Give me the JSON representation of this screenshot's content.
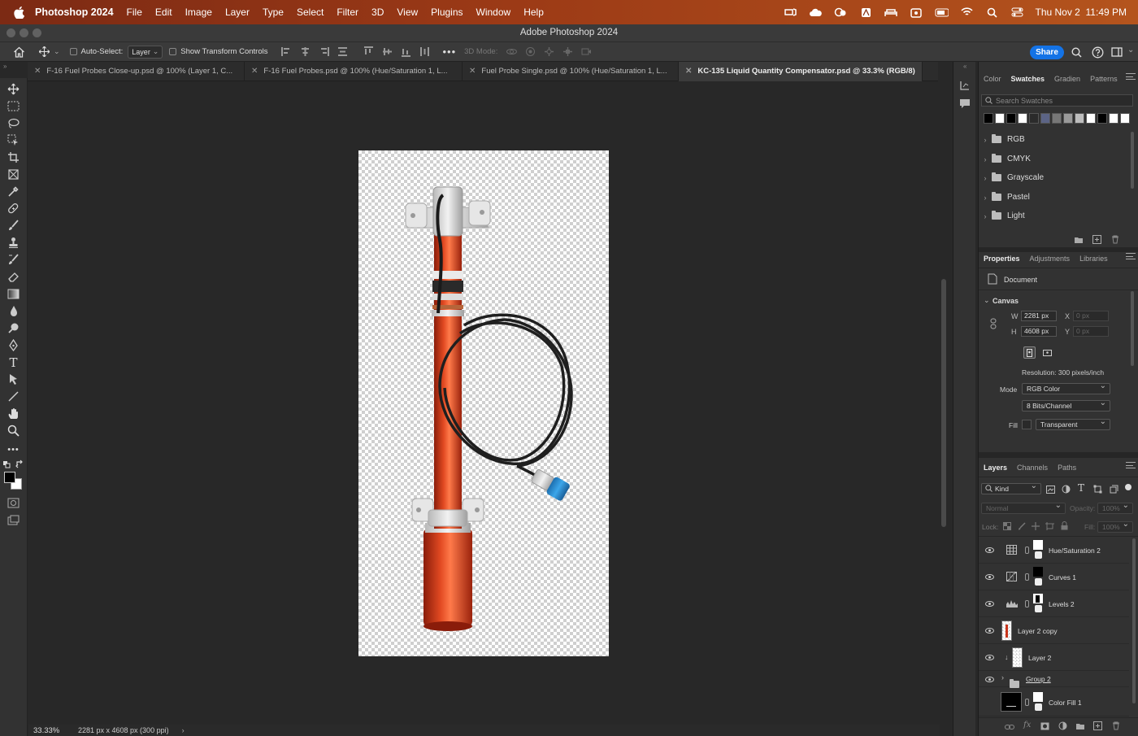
{
  "menubar": {
    "app_name": "Photoshop 2024",
    "items": [
      "File",
      "Edit",
      "Image",
      "Layer",
      "Type",
      "Select",
      "Filter",
      "3D",
      "View",
      "Plugins",
      "Window",
      "Help"
    ],
    "clock": "Thu Nov 2  11:49 PM"
  },
  "window": {
    "title": "Adobe Photoshop 2024"
  },
  "options_bar": {
    "auto_select_label": "Auto-Select:",
    "auto_select_value": "Layer",
    "show_transform_label": "Show Transform Controls",
    "mode_3d_label": "3D Mode:",
    "share_label": "Share"
  },
  "tabs": [
    {
      "label": "F-16 Fuel Probes Close-up.psd @ 100% (Layer 1, C...",
      "active": false
    },
    {
      "label": "F-16 Fuel Probes.psd @ 100% (Hue/Saturation 1, L...",
      "active": false
    },
    {
      "label": "Fuel Probe Single.psd @ 100% (Hue/Saturation 1, L...",
      "active": false
    },
    {
      "label": "KC-135 Liquid Quantity Compensator.psd @ 33.3% (RGB/8)",
      "active": true
    }
  ],
  "status": {
    "zoom": "33.33%",
    "doc_info": "2281 px x 4608 px (300 ppi)",
    "arrow": "›"
  },
  "swatches_panel": {
    "tabs": [
      "Color",
      "Swatches",
      "Gradien",
      "Patterns"
    ],
    "active_tab": "Swatches",
    "search_placeholder": "Search Swatches",
    "recent_colors": [
      "#000000",
      "#ffffff",
      "#000000",
      "#ffffff",
      "#2b2b2b",
      "#5c6485",
      "#777777",
      "#9a9a9a",
      "#bdbdbd",
      "#ffffff",
      "#000000",
      "#ffffff",
      "#ffffff"
    ],
    "groups": [
      "RGB",
      "CMYK",
      "Grayscale",
      "Pastel",
      "Light"
    ]
  },
  "properties_panel": {
    "tabs": [
      "Properties",
      "Adjustments",
      "Libraries"
    ],
    "active_tab": "Properties",
    "doc_label": "Document",
    "section": "Canvas",
    "w_label": "W",
    "w_value": "2281 px",
    "h_label": "H",
    "h_value": "4608 px",
    "x_label": "X",
    "x_value": "0 px",
    "y_label": "Y",
    "y_value": "0 px",
    "resolution": "Resolution: 300 pixels/inch",
    "mode_label": "Mode",
    "mode_value": "RGB Color",
    "depth_value": "8 Bits/Channel",
    "fill_label": "Fill",
    "fill_value": "Transparent"
  },
  "layers_panel": {
    "tabs": [
      "Layers",
      "Channels",
      "Paths"
    ],
    "active_tab": "Layers",
    "filter_value": "Kind",
    "blend_mode": "Normal",
    "opacity_label": "Opacity:",
    "opacity_value": "100%",
    "lock_label": "Lock:",
    "fill_label": "Fill:",
    "fill_value": "100%",
    "layers": [
      {
        "name": "Hue/Saturation 2",
        "visible": true
      },
      {
        "name": "Curves 1",
        "visible": true
      },
      {
        "name": "Levels 2",
        "visible": true
      },
      {
        "name": "Layer 2 copy",
        "visible": true
      },
      {
        "name": "Layer 2",
        "visible": true
      },
      {
        "name": "Group 2",
        "visible": true
      },
      {
        "name": "Color Fill 1",
        "visible": false
      }
    ]
  },
  "colors": {
    "share_blue": "#1473e6",
    "probe_red": "#d2361a",
    "cap_blue": "#2a8fd6"
  }
}
